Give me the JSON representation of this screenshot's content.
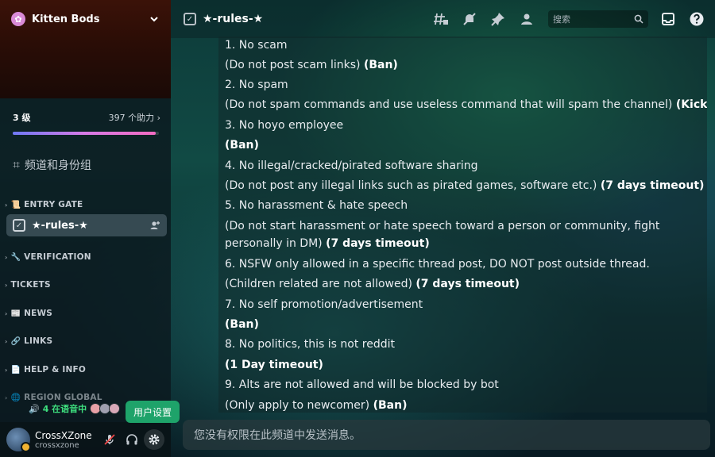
{
  "server": {
    "name": "Kitten Bods",
    "boost_level": "3 级",
    "boost_count": "397 个助力",
    "boost_progress": 0.98
  },
  "sidebar": {
    "channels_roles": "频道和身份组",
    "categories": [
      {
        "emoji": "📜",
        "label": "ENTRY GATE"
      },
      {
        "emoji": "🔧",
        "label": "VERIFICATION"
      },
      {
        "emoji": "",
        "label": "TICKETS"
      },
      {
        "emoji": "📰",
        "label": "NEWS"
      },
      {
        "emoji": "🔗",
        "label": "LINKS"
      },
      {
        "emoji": "📄",
        "label": "HELP & INFO"
      },
      {
        "emoji": "🌐",
        "label": "REGION GLOBAL"
      }
    ],
    "active_channel": "★-rules-★",
    "voice_status": "4 在语音中",
    "tooltip": "用户设置"
  },
  "user": {
    "display_name": "CrossXZone",
    "username": "crossxzone"
  },
  "header": {
    "channel_title": "★-rules-★",
    "search_placeholder": "搜索"
  },
  "rules": [
    {
      "text": "1. No scam",
      "bold": ""
    },
    {
      "text": "(Do not post scam links) ",
      "bold": "(Ban)"
    },
    {
      "text": "2. No spam",
      "bold": ""
    },
    {
      "text": "(Do not spam commands and use useless command that will spam the channel) ",
      "bold": "(Kick)"
    },
    {
      "text": "3. No hoyo employee",
      "bold": ""
    },
    {
      "text": "",
      "bold": "(Ban)"
    },
    {
      "text": "4. No illegal/cracked/pirated software sharing",
      "bold": ""
    },
    {
      "text": "(Do not post any illegal links such as pirated games, software etc.) ",
      "bold": "(7 days timeout)"
    },
    {
      "text": "5. No harassment & hate speech",
      "bold": ""
    },
    {
      "text": "(Do not start harassment or hate speech toward a person or community, fight personally in DM) ",
      "bold": "(7 days timeout)"
    },
    {
      "text": "6. NSFW only allowed in a specific thread post, DO NOT post outside thread.",
      "bold": ""
    },
    {
      "text": "(Children related are not allowed) ",
      "bold": "(7 days timeout)"
    },
    {
      "text": "7. No self promotion/advertisement",
      "bold": ""
    },
    {
      "text": "",
      "bold": "(Ban)"
    },
    {
      "text": "8. No politics, this is not reddit",
      "bold": ""
    },
    {
      "text": "",
      "bold": "(1 Day timeout)"
    },
    {
      "text": "9. Alts are not allowed and will be blocked by bot",
      "bold": ""
    },
    {
      "text": "(Only apply to newcomer) ",
      "bold": "(Ban)"
    }
  ],
  "composer": {
    "placeholder": "您没有权限在此频道中发送消息。"
  },
  "colors": {
    "accent_green": "#1ea36a",
    "voice_green": "#3ee07f",
    "boost_gradient_start": "#6f79f5",
    "boost_gradient_end": "#f36bc2"
  }
}
